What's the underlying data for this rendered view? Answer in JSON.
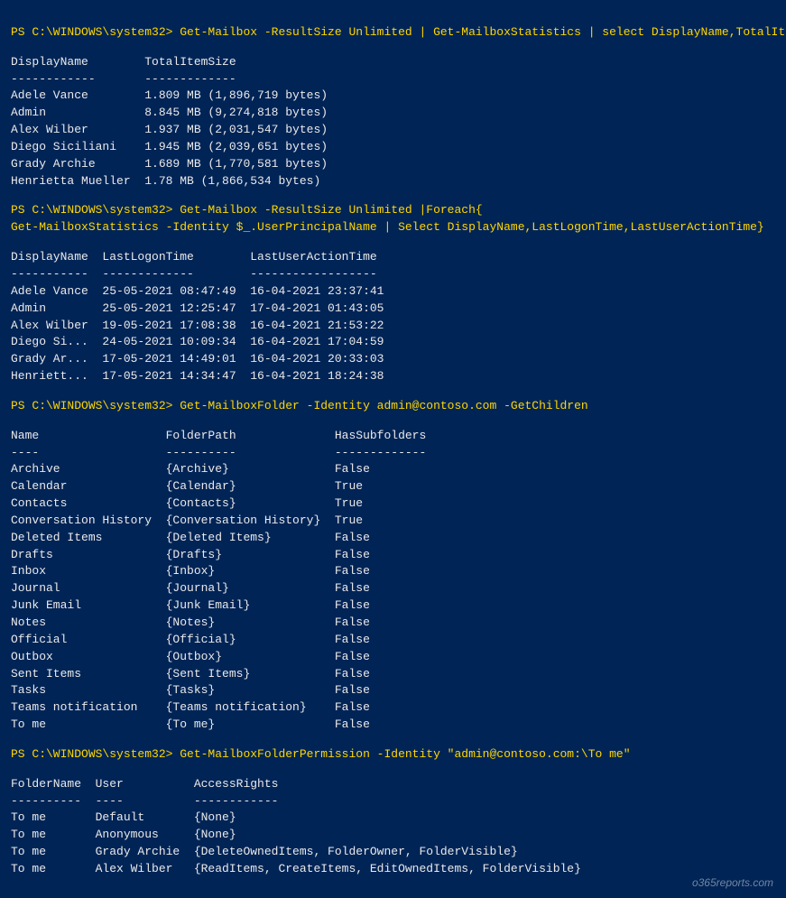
{
  "watermark": "o365reports.com",
  "sections": [
    {
      "id": "section1",
      "command": "PS C:\\WINDOWS\\system32> Get-Mailbox -ResultSize Unlimited | Get-MailboxStatistics | select DisplayName,TotalItemSize",
      "headers": [
        "DisplayName",
        "TotalItemSize"
      ],
      "separator": [
        "------------",
        "-------------"
      ],
      "rows": [
        [
          "Adele Vance",
          "1.809 MB (1,896,719 bytes)"
        ],
        [
          "Admin",
          "8.845 MB (9,274,818 bytes)"
        ],
        [
          "Alex Wilber",
          "1.937 MB (2,031,547 bytes)"
        ],
        [
          "Diego Siciliani",
          "1.945 MB (2,039,651 bytes)"
        ],
        [
          "Grady Archie",
          "1.689 MB (1,770,581 bytes)"
        ],
        [
          "Henrietta Mueller",
          "1.78 MB (1,866,534 bytes)"
        ]
      ]
    },
    {
      "id": "section2",
      "command": "PS C:\\WINDOWS\\system32> Get-Mailbox -ResultSize Unlimited |Foreach{\nGet-MailboxStatistics -Identity $_.UserPrincipalName | Select DisplayName,LastLogonTime,LastUserActionTime}",
      "headers": [
        "DisplayName",
        "LastLogonTime",
        "LastUserActionTime"
      ],
      "separator": [
        "-----------",
        "-------------",
        "------------------"
      ],
      "rows": [
        [
          "Adele Vance",
          "25-05-2021 08:47:49",
          "16-04-2021 23:37:41"
        ],
        [
          "Admin",
          "25-05-2021 12:25:47",
          "17-04-2021 01:43:05"
        ],
        [
          "Alex Wilber",
          "19-05-2021 17:08:38",
          "16-04-2021 21:53:22"
        ],
        [
          "Diego Si...",
          "24-05-2021 10:09:34",
          "16-04-2021 17:04:59"
        ],
        [
          "Grady Ar...",
          "17-05-2021 14:49:01",
          "16-04-2021 20:33:03"
        ],
        [
          "Henriett...",
          "17-05-2021 14:34:47",
          "16-04-2021 18:24:38"
        ]
      ]
    },
    {
      "id": "section3",
      "command": "PS C:\\WINDOWS\\system32> Get-MailboxFolder -Identity admin@contoso.com -GetChildren",
      "headers": [
        "Name",
        "FolderPath",
        "HasSubfolders"
      ],
      "separator": [
        "----",
        "----------",
        "-------------"
      ],
      "rows": [
        [
          "Archive",
          "{Archive}",
          "False"
        ],
        [
          "Calendar",
          "{Calendar}",
          "True"
        ],
        [
          "Contacts",
          "{Contacts}",
          "True"
        ],
        [
          "Conversation History",
          "{Conversation History}",
          "True"
        ],
        [
          "Deleted Items",
          "{Deleted Items}",
          "False"
        ],
        [
          "Drafts",
          "{Drafts}",
          "False"
        ],
        [
          "Inbox",
          "{Inbox}",
          "False"
        ],
        [
          "Journal",
          "{Journal}",
          "False"
        ],
        [
          "Junk Email",
          "{Junk Email}",
          "False"
        ],
        [
          "Notes",
          "{Notes}",
          "False"
        ],
        [
          "Official",
          "{Official}",
          "False"
        ],
        [
          "Outbox",
          "{Outbox}",
          "False"
        ],
        [
          "Sent Items",
          "{Sent Items}",
          "False"
        ],
        [
          "Tasks",
          "{Tasks}",
          "False"
        ],
        [
          "Teams notification",
          "{Teams notification}",
          "False"
        ],
        [
          "To me",
          "{To me}",
          "False"
        ]
      ]
    },
    {
      "id": "section4",
      "command": "PS C:\\WINDOWS\\system32> Get-MailboxFolderPermission -Identity \"admin@contoso.com:\\To me\"",
      "headers": [
        "FolderName",
        "User",
        "AccessRights"
      ],
      "separator": [
        "----------",
        "----",
        "------------"
      ],
      "rows": [
        [
          "To me",
          "Default",
          "{None}"
        ],
        [
          "To me",
          "Anonymous",
          "{None}"
        ],
        [
          "To me",
          "Grady Archie",
          "{DeleteOwnedItems, FolderOwner, FolderVisible}"
        ],
        [
          "To me",
          "Alex Wilber",
          "{ReadItems, CreateItems, EditOwnedItems, FolderVisible}"
        ]
      ]
    }
  ]
}
